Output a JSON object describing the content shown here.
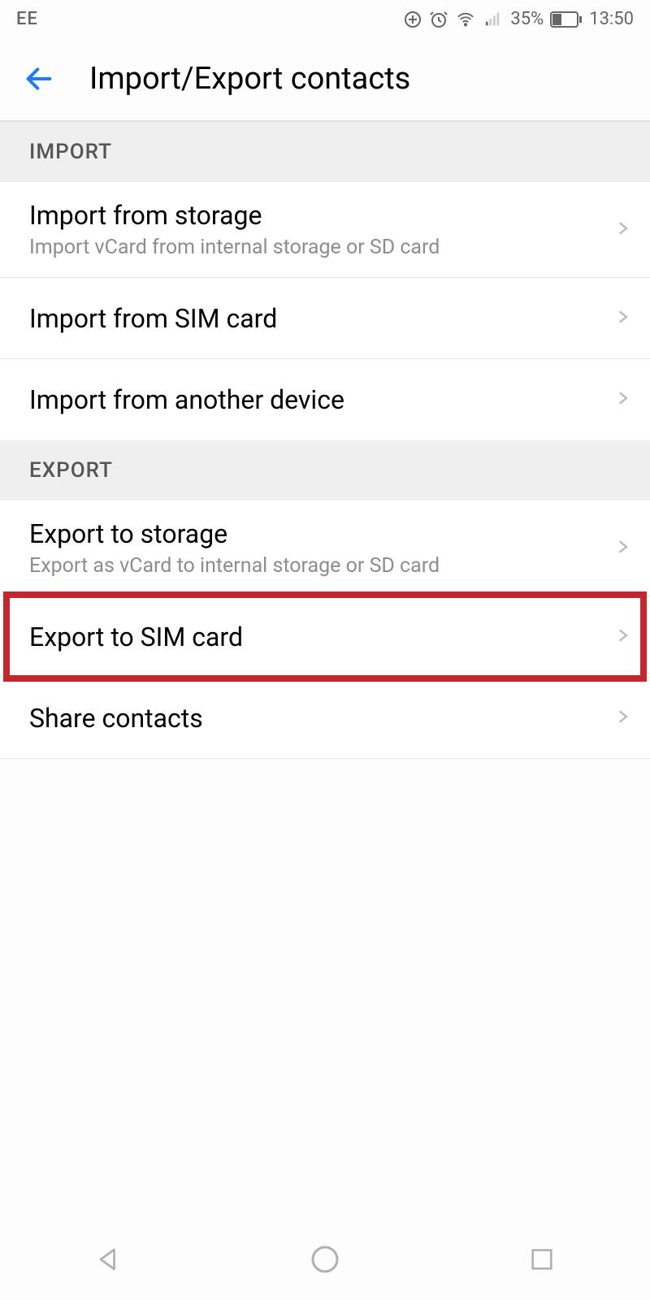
{
  "statusbar": {
    "carrier": "EE",
    "battery_pct": "35%",
    "time": "13:50"
  },
  "header": {
    "title": "Import/Export contacts"
  },
  "sections": {
    "import_label": "IMPORT",
    "export_label": "EXPORT"
  },
  "rows": {
    "import_storage": {
      "title": "Import from storage",
      "sub": "Import vCard from internal storage or SD card"
    },
    "import_sim": {
      "title": "Import from SIM card"
    },
    "import_device": {
      "title": "Import from another device"
    },
    "export_storage": {
      "title": "Export to storage",
      "sub": "Export as vCard to internal storage or SD card"
    },
    "export_sim": {
      "title": "Export to SIM card"
    },
    "share": {
      "title": "Share contacts"
    }
  }
}
